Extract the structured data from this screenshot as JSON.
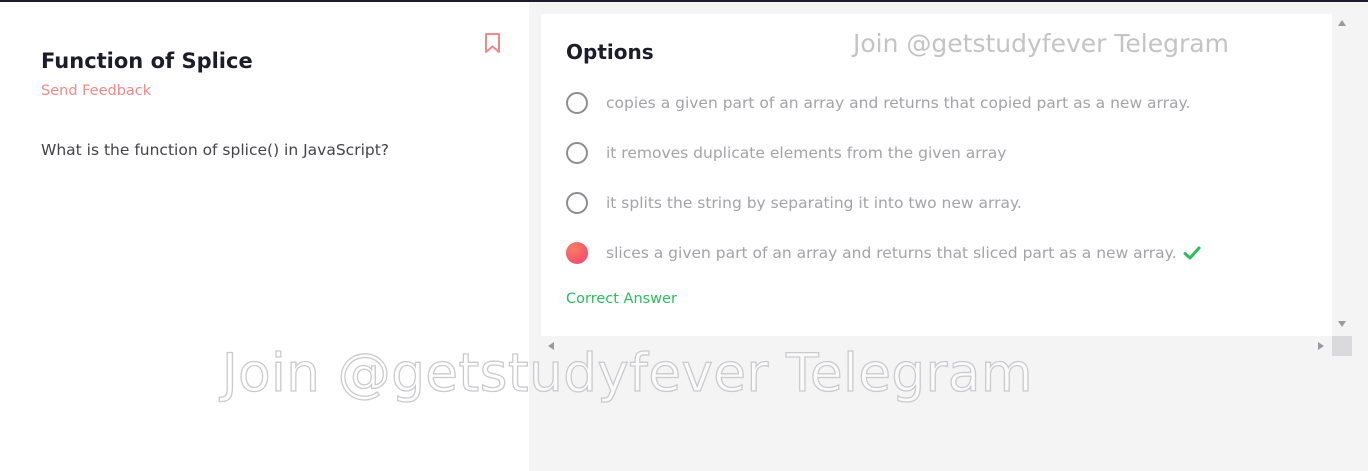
{
  "question": {
    "title": "Function of Splice",
    "feedback_label": "Send Feedback",
    "text": "What is the function of splice() in JavaScript?"
  },
  "options": {
    "title": "Options",
    "items": [
      {
        "label": "copies a given part of an array and returns that copied part as a new array.",
        "selected": false
      },
      {
        "label": "it removes duplicate elements from the given array",
        "selected": false
      },
      {
        "label": "it splits the string by separating it into two new array.",
        "selected": false
      },
      {
        "label": "slices a given part of an array and returns that sliced part as a new array.",
        "selected": true
      }
    ],
    "correct_label": "Correct Answer"
  },
  "watermark": {
    "small": "Join @getstudyfever Telegram",
    "large": "Join @getstudyfever Telegram"
  },
  "icons": {
    "bookmark": "bookmark-icon",
    "check": "check-icon"
  },
  "colors": {
    "accent": "#f08a86",
    "correct": "#2bbd5e",
    "selected_radio": "#f6566c"
  }
}
